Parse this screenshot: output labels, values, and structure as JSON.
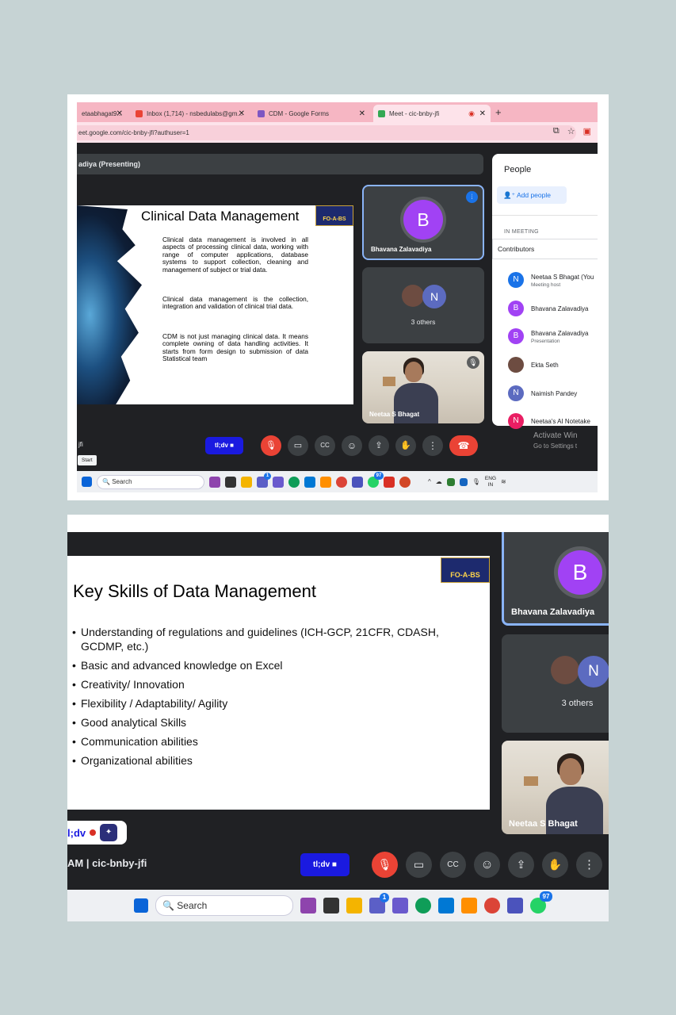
{
  "screenshot1": {
    "tabs": [
      {
        "label": "etaabhagat9...",
        "active": false
      },
      {
        "label": "Inbox (1,714) - nsbedulabs@gm...",
        "active": false
      },
      {
        "label": "CDM - Google Forms",
        "active": false
      },
      {
        "label": "Meet - cic-bnby-jfi",
        "active": true
      }
    ],
    "url": "eet.google.com/cic-bnby-jfi?authuser=1",
    "presenting": "adiya (Presenting)",
    "slide": {
      "logo": "FO-A-BS",
      "title": "Clinical Data Management",
      "paragraphs": [
        "Clinical data management is involved in all aspects of processing clinical data, working with range of computer applications, database systems to support collection, cleaning and management of subject or trial data.",
        "Clinical data management is the collection, integration and validation of clinical trial data.",
        "CDM is not just managing clinical data. It means complete owning of data handling activities. It starts from form design to submission of data Statistical team"
      ]
    },
    "tiles": {
      "main_speaker": {
        "initial": "B",
        "name": "Bhavana Zalavadiya"
      },
      "others": {
        "initial": "N",
        "label": "3 others"
      },
      "self": {
        "name": "Neetaa S Bhagat"
      }
    },
    "people_panel": {
      "title": "People",
      "add_button": "Add people",
      "section": "IN MEETING",
      "group": "Contributors",
      "participants": [
        {
          "initial": "N",
          "name": "Neetaa S Bhagat (You",
          "sub": "Meeting host",
          "color": "#1a73e8"
        },
        {
          "initial": "B",
          "name": "Bhavana Zalavadiya",
          "sub": "",
          "color": "#a142f4"
        },
        {
          "initial": "B",
          "name": "Bhavana Zalavadiya",
          "sub": "Presentation",
          "color": "#a142f4"
        },
        {
          "initial": "",
          "name": "Ekta Seth",
          "sub": "",
          "color": "#8d6e63"
        },
        {
          "initial": "N",
          "name": "Naimish Pandey",
          "sub": "",
          "color": "#5c6bc0"
        },
        {
          "initial": "N",
          "name": "Neetaa's AI Notetake",
          "sub": "",
          "color": "#e91e63"
        }
      ]
    },
    "meeting_left": "jfi",
    "present_stop_label": "tl;dv",
    "activate_windows": {
      "line1": "Activate Win",
      "line2": "Go to Settings t"
    },
    "start_tooltip": "Start",
    "taskbar": {
      "search_placeholder": "Search",
      "lang": "ENG",
      "region": "IN",
      "teams_badge": "1",
      "whatsapp_badge": "97"
    }
  },
  "screenshot2": {
    "slide": {
      "logo": "FO-A-BS",
      "title": "Key Skills of Data Management",
      "bullets": [
        "Understanding of regulations and guidelines (ICH-GCP, 21CFR, CDASH, GCDMP, etc.)",
        "Basic and advanced knowledge on Excel",
        "Creativity/ Innovation",
        "Flexibility / Adaptability/ Agility",
        "Good analytical Skills",
        "Communication abilities",
        "Organizational abilities"
      ]
    },
    "tiles": {
      "main_speaker": {
        "initial": "B",
        "name": "Bhavana Zalavadiya"
      },
      "others": {
        "initial": "N",
        "label": "3 others"
      },
      "self": {
        "name": "Neetaa S Bhagat"
      }
    },
    "recording_pill": "l;dv",
    "meeting_code": "AM  |  cic-bnby-jfi",
    "present_stop_label": "tl;dv",
    "taskbar": {
      "search_placeholder": "Search",
      "teams_badge": "1",
      "whatsapp_badge": "97"
    }
  }
}
